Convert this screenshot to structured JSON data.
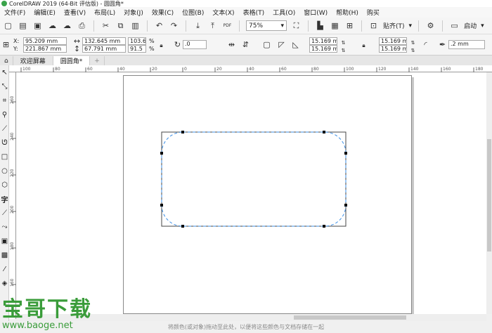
{
  "window": {
    "title": "CorelDRAW 2019 (64-Bit 评估版) - 圆圆角*"
  },
  "menu": [
    "文件(F)",
    "编辑(E)",
    "查看(V)",
    "布局(L)",
    "对象(J)",
    "效果(C)",
    "位图(B)",
    "文本(X)",
    "表格(T)",
    "工具(O)",
    "窗口(W)",
    "帮助(H)",
    "购买"
  ],
  "toolbar": {
    "zoom": "75%",
    "snap_label": "贴齐(T)",
    "launch_label": "启动",
    "pdf_label": "PDF"
  },
  "properties": {
    "x_label": "X:",
    "y_label": "Y:",
    "x": "95.209 mm",
    "y": "221.867 mm",
    "width": "132.645 mm",
    "height": "67.791 mm",
    "scale_w": "103.6",
    "scale_h": "91.5",
    "pct": "%",
    "rotation": ".0",
    "corner_tl": "15.169 mm",
    "corner_bl": "15.169 mm",
    "corner_tr": "15.169 mm",
    "corner_br": "15.169 mm",
    "outline": ".2 mm"
  },
  "tabs": [
    {
      "label": "欢迎屏幕"
    },
    {
      "label": "圆圆角*"
    }
  ],
  "ruler_h": [
    "100",
    "80",
    "60",
    "40",
    "20",
    "0",
    "20",
    "40",
    "60",
    "80",
    "100",
    "120",
    "140",
    "160",
    "180"
  ],
  "ruler_v": [
    "260",
    "240",
    "220",
    "200",
    "180",
    "160"
  ],
  "status": {
    "hint": "将颜色(或对象)拖动至此处，以便将这些颜色与文档存储在一起"
  },
  "watermark": {
    "title": "宝哥下载",
    "url": "www.baoge.net"
  }
}
